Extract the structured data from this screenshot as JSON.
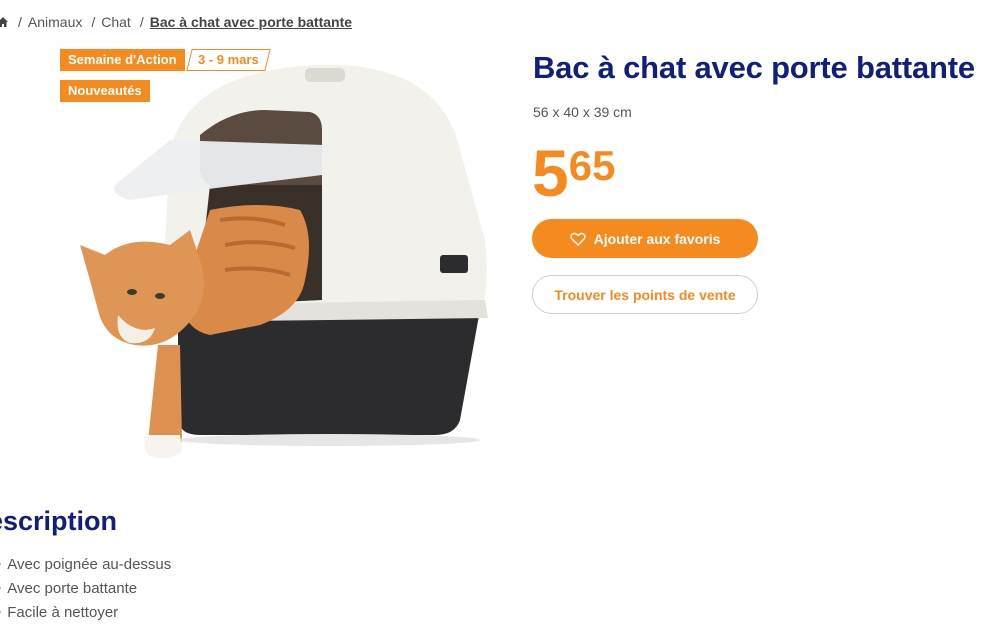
{
  "breadcrumb": {
    "home_icon": "home-icon",
    "items": [
      "Animaux",
      "Chat"
    ],
    "current": "Bac à chat avec porte battante",
    "separator": "/"
  },
  "badges": {
    "promo": "Semaine d'Action",
    "promo_dates": "3 - 9 mars",
    "new": "Nouveautés"
  },
  "product": {
    "title": "Bac à chat avec porte battante",
    "dimensions": "56 x 40 x 39 cm",
    "price_int": "5",
    "price_dec": "65",
    "favorite_label": "Ajouter aux favoris",
    "favorite_icon": "heart-icon",
    "store_label": "Trouver les points de vente"
  },
  "description": {
    "heading": "escription",
    "items": [
      "Avec poignée au-dessus",
      "Avec porte battante",
      "Facile à nettoyer"
    ]
  },
  "colors": {
    "accent": "#f58a1f",
    "title": "#0f1f7a"
  }
}
